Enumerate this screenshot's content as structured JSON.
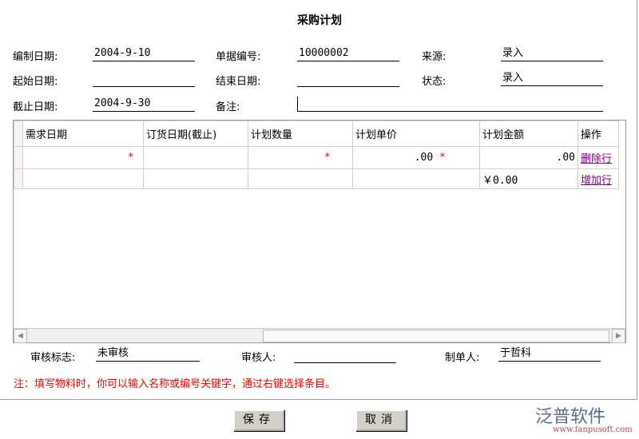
{
  "title": "采购计划",
  "form": {
    "compile_date_label": "编制日期:",
    "compile_date": "2004-9-10",
    "doc_no_label": "单据编号:",
    "doc_no": "10000002",
    "source_label": "来源:",
    "source": "录入",
    "start_date_label": "起始日期:",
    "start_date": "",
    "end_date_label": "结束日期:",
    "end_date": "",
    "status_label": "状态:",
    "status": "录入",
    "deadline_label": "截止日期:",
    "deadline": "2004-9-30",
    "remark_label": "备注:",
    "remark": ""
  },
  "table": {
    "headers": [
      "需求日期",
      "订货日期(截止)",
      "计划数量",
      "计划单价",
      "计划金额",
      "操作"
    ],
    "row1": {
      "unit_price": ".00",
      "amount": ".00",
      "action": "删除行"
    },
    "row2": {
      "total": "￥0.00",
      "action": "增加行"
    },
    "required_mark": "*"
  },
  "footer": {
    "audit_flag_label": "审核标志:",
    "audit_flag": "未审核",
    "auditor_label": "审核人:",
    "auditor": "",
    "creator_label": "制单人:",
    "creator": "于哲科",
    "note": "注：填写物料时，你可以输入名称或编号关键字，通过右键选择条目。"
  },
  "buttons": {
    "save": "保存",
    "cancel": "取消"
  },
  "logo": {
    "name": "泛普软件",
    "url": "www.fanpusoft.com"
  }
}
